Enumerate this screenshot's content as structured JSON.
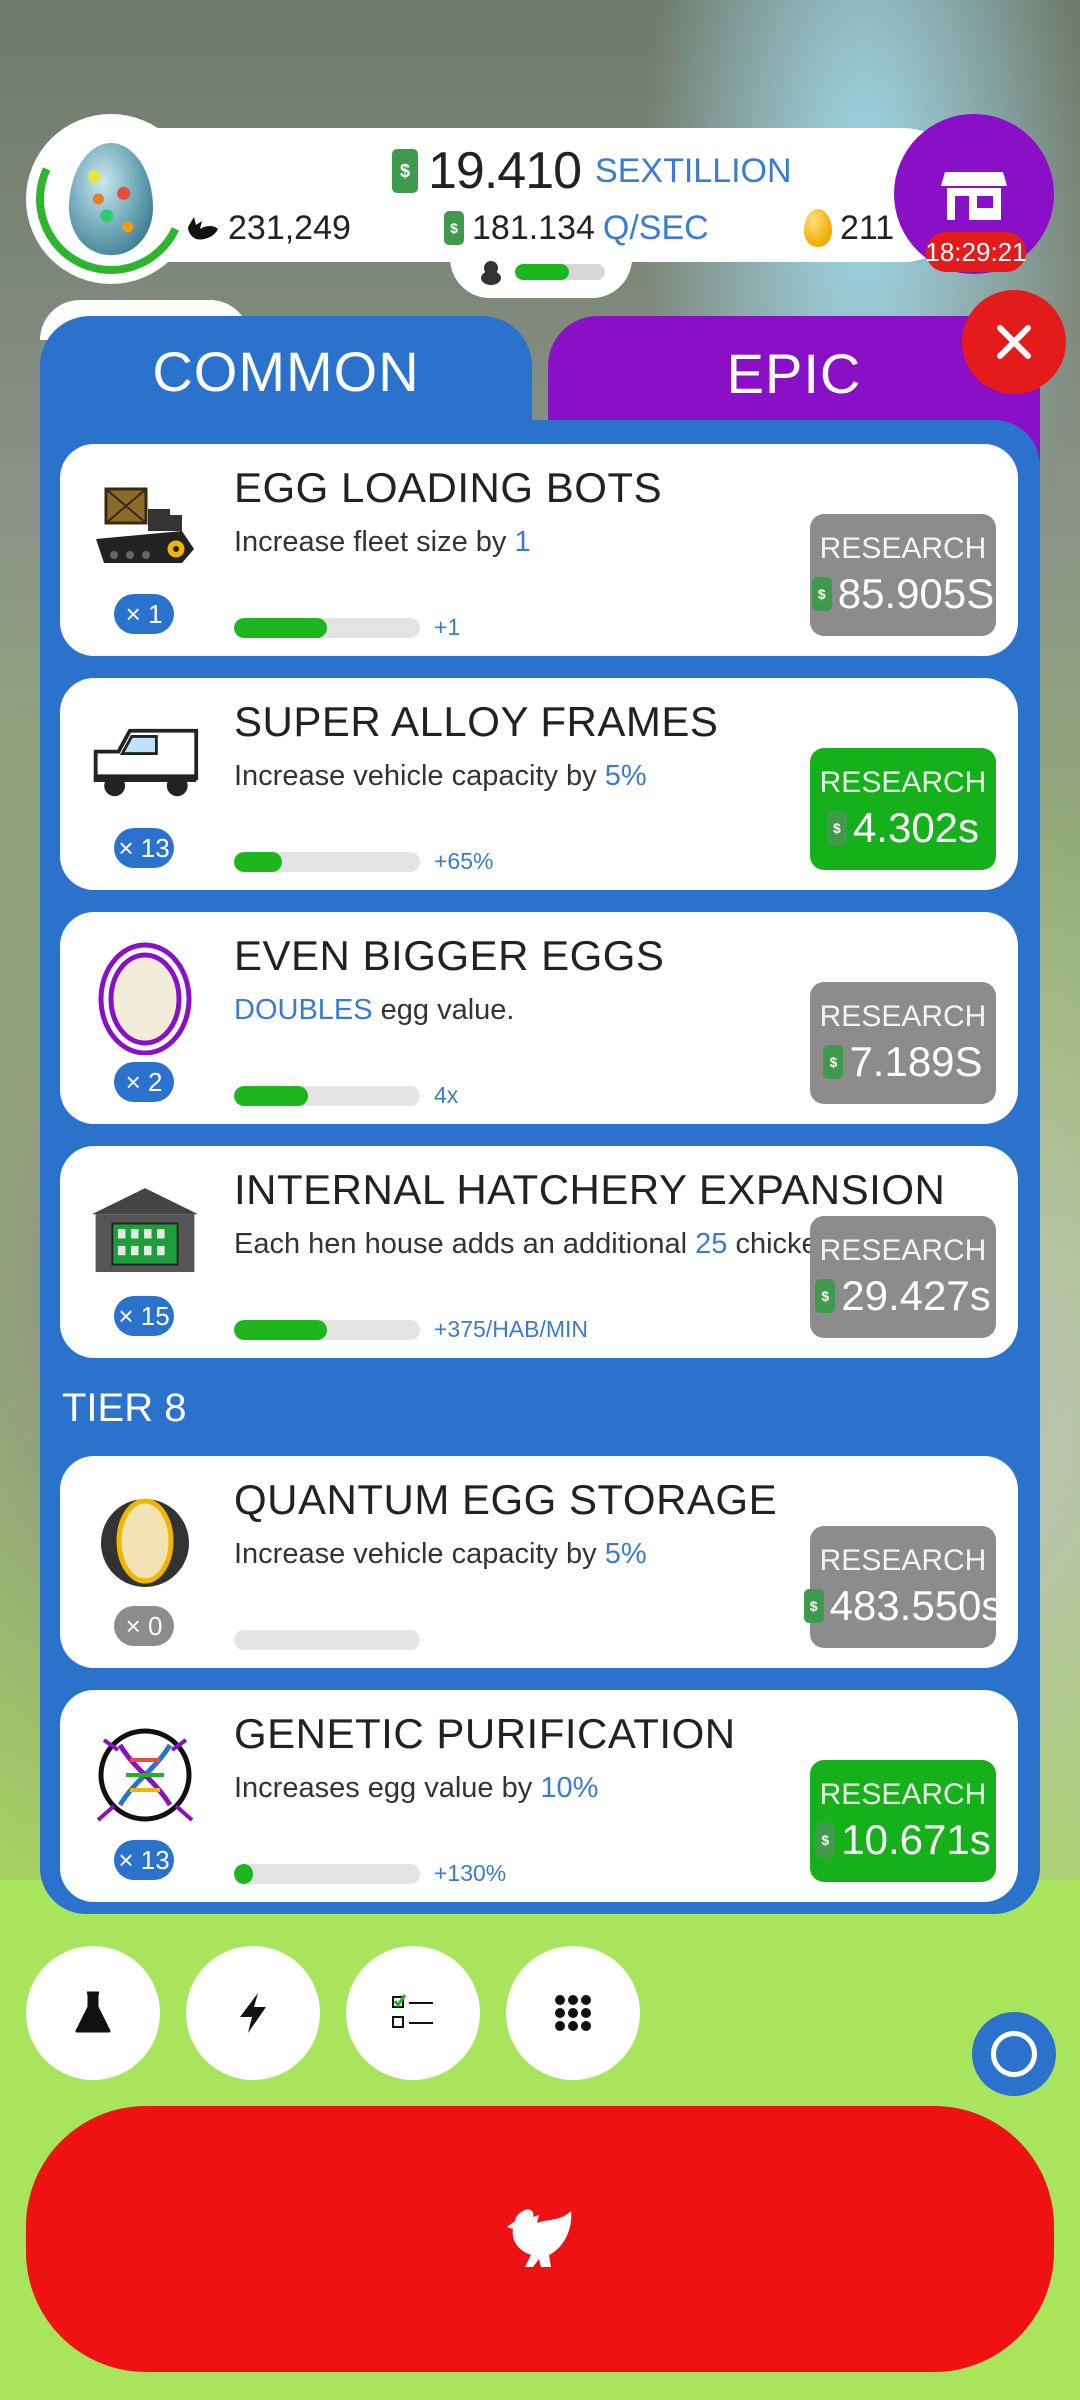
{
  "header": {
    "money_value": "19.410",
    "money_unit": "SEXTILLION",
    "chicken_count": "231,249",
    "rate_value": "181.134",
    "rate_unit": "Q/SEC",
    "golden_eggs": "211",
    "shop_timer": "18:29:21",
    "habitat_progress": 0.6
  },
  "tabs": {
    "common": "COMMON",
    "epic": "EPIC"
  },
  "research_label": "RESEARCH",
  "tier_label": "TIER 8",
  "items": [
    {
      "title": "EGG LOADING BOTS",
      "desc_pre": "Increase fleet size by ",
      "desc_hl": "1",
      "desc_post": "",
      "bonus": "+1",
      "count": "× 1",
      "cost": "85.905S",
      "state": "grey",
      "icon": "loading-bot-icon",
      "progress": 0.5
    },
    {
      "title": "SUPER ALLOY FRAMES",
      "desc_pre": "Increase vehicle capacity by ",
      "desc_hl": "5%",
      "desc_post": "",
      "bonus": "+65%",
      "count": "× 13",
      "cost": "4.302s",
      "state": "green",
      "icon": "truck-icon",
      "progress": 0.26
    },
    {
      "title": "EVEN BIGGER EGGS",
      "desc_pre": "",
      "desc_hl": "DOUBLES",
      "desc_post": " egg value.",
      "bonus": "4x",
      "count": "× 2",
      "cost": "7.189S",
      "state": "grey",
      "icon": "big-egg-icon",
      "progress": 0.4
    },
    {
      "title": "INTERNAL HATCHERY EXPANSION",
      "desc_pre": "Each hen house adds an additional ",
      "desc_hl": "25",
      "desc_post": " chickens/min",
      "bonus": "+375/HAB/MIN",
      "count": "× 15",
      "cost": "29.427s",
      "state": "grey",
      "icon": "hatchery-icon",
      "progress": 0.5
    },
    {
      "title": "QUANTUM EGG STORAGE",
      "desc_pre": "Increase vehicle capacity by ",
      "desc_hl": "5%",
      "desc_post": "",
      "bonus": "",
      "count": "× 0",
      "cost": "483.550s",
      "state": "grey",
      "icon": "quantum-egg-icon",
      "progress": 0
    },
    {
      "title": "GENETIC PURIFICATION",
      "desc_pre": "Increases egg value by ",
      "desc_hl": "10%",
      "desc_post": "",
      "bonus": "+130%",
      "count": "× 13",
      "cost": "10.671s",
      "state": "green",
      "icon": "dna-icon",
      "progress": 0.1
    }
  ],
  "bottom": {
    "buttons": [
      "flask-icon",
      "lightning-icon",
      "checklist-icon",
      "grid-icon"
    ]
  },
  "colors": {
    "panel_blue": "#2a72cc",
    "epic_purple": "#8a10c8",
    "research_green": "#16b01a",
    "research_grey": "#8c8c8c",
    "hatch_red": "#ee1212",
    "highlight_blue": "#3a7bd5"
  }
}
